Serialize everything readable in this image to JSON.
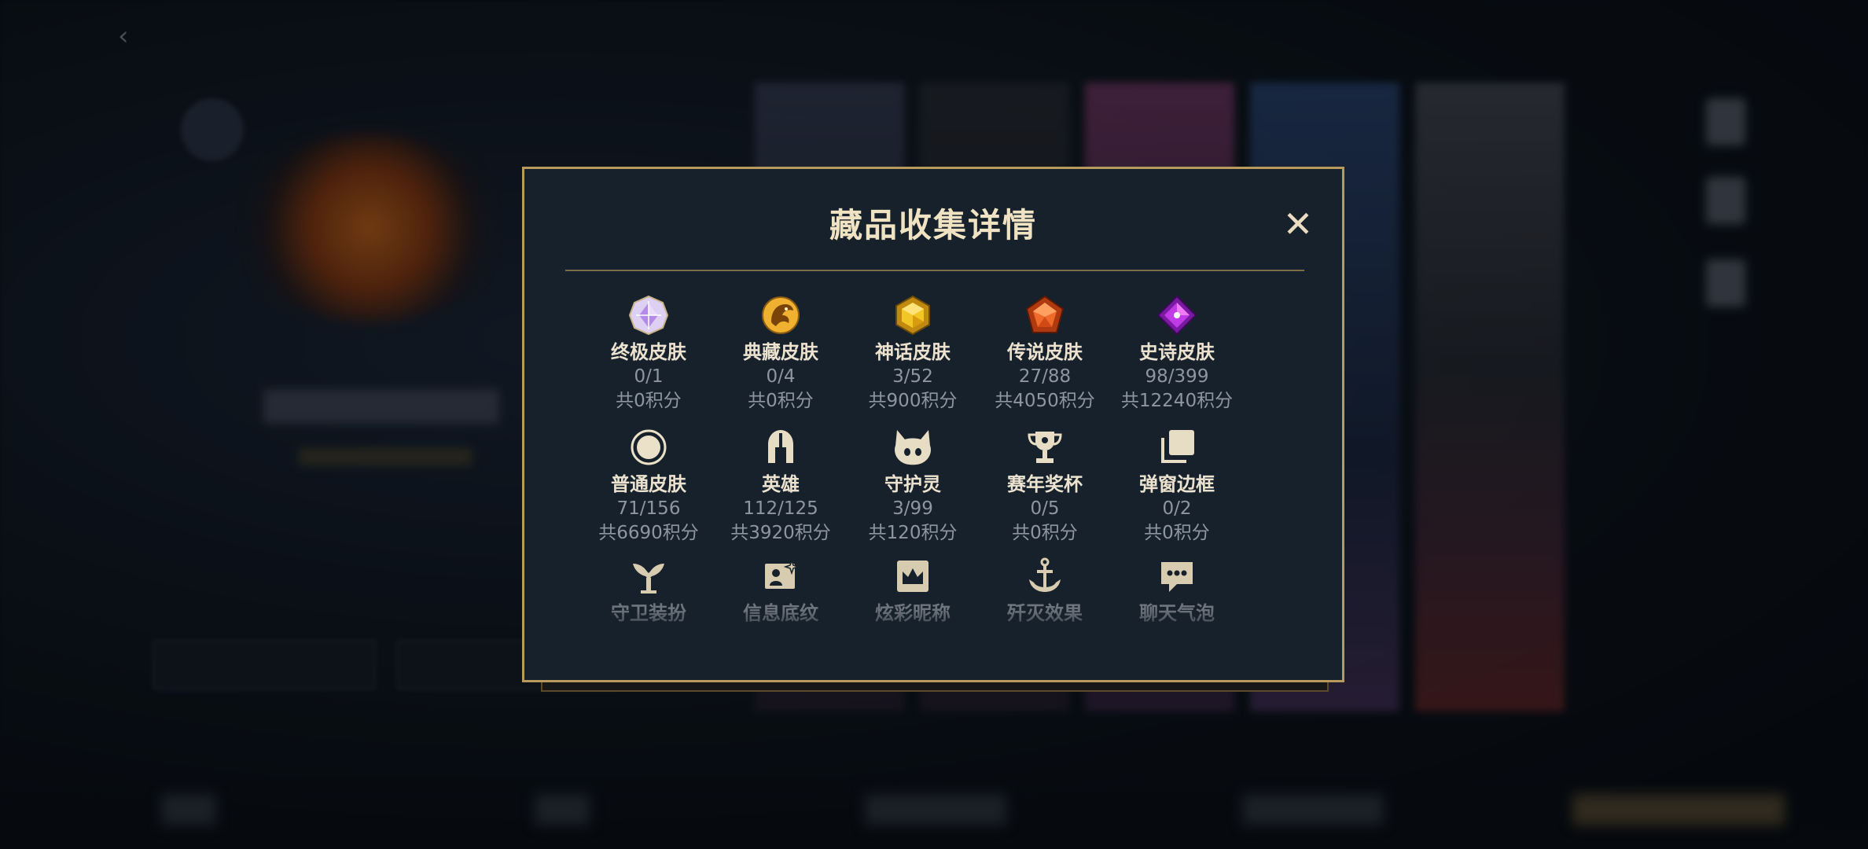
{
  "modal": {
    "title": "藏品收集详情",
    "close_label": "✕",
    "items": [
      {
        "label": "终极皮肤",
        "count": "0/1",
        "points": "共0积分",
        "icon": "ultimate-gem-icon",
        "color": "#c8a8f0"
      },
      {
        "label": "典藏皮肤",
        "count": "0/4",
        "points": "共0积分",
        "icon": "dragon-emblem-icon",
        "color": "#e0a030"
      },
      {
        "label": "神话皮肤",
        "count": "3/52",
        "points": "共900积分",
        "icon": "mythic-gem-icon",
        "color": "#e9b82a"
      },
      {
        "label": "传说皮肤",
        "count": "27/88",
        "points": "共4050积分",
        "icon": "legendary-gem-icon",
        "color": "#e8582a"
      },
      {
        "label": "史诗皮肤",
        "count": "98/399",
        "points": "共12240积分",
        "icon": "epic-gem-icon",
        "color": "#b63adb"
      },
      {
        "label": "普通皮肤",
        "count": "71/156",
        "points": "共6690积分",
        "icon": "ring-icon",
        "color": "#e7dcc4"
      },
      {
        "label": "英雄",
        "count": "112/125",
        "points": "共3920积分",
        "icon": "helmet-icon",
        "color": "#e7dcc4"
      },
      {
        "label": "守护灵",
        "count": "3/99",
        "points": "共120积分",
        "icon": "guardian-pet-icon",
        "color": "#e7dcc4"
      },
      {
        "label": "赛年奖杯",
        "count": "0/5",
        "points": "共0积分",
        "icon": "trophy-icon",
        "color": "#e7dcc4"
      },
      {
        "label": "弹窗边框",
        "count": "0/2",
        "points": "共0积分",
        "icon": "frame-stack-icon",
        "color": "#e7dcc4"
      },
      {
        "label": "守卫装扮",
        "icon": "ward-icon",
        "color": "#d8ccb0"
      },
      {
        "label": "信息底纹",
        "icon": "profile-card-icon",
        "color": "#d8ccb0"
      },
      {
        "label": "炫彩昵称",
        "icon": "crown-frame-icon",
        "color": "#d8ccb0"
      },
      {
        "label": "歼灭效果",
        "icon": "anchor-icon",
        "color": "#d8ccb0"
      },
      {
        "label": "聊天气泡",
        "icon": "chat-bubble-icon",
        "color": "#d8ccb0"
      }
    ]
  }
}
